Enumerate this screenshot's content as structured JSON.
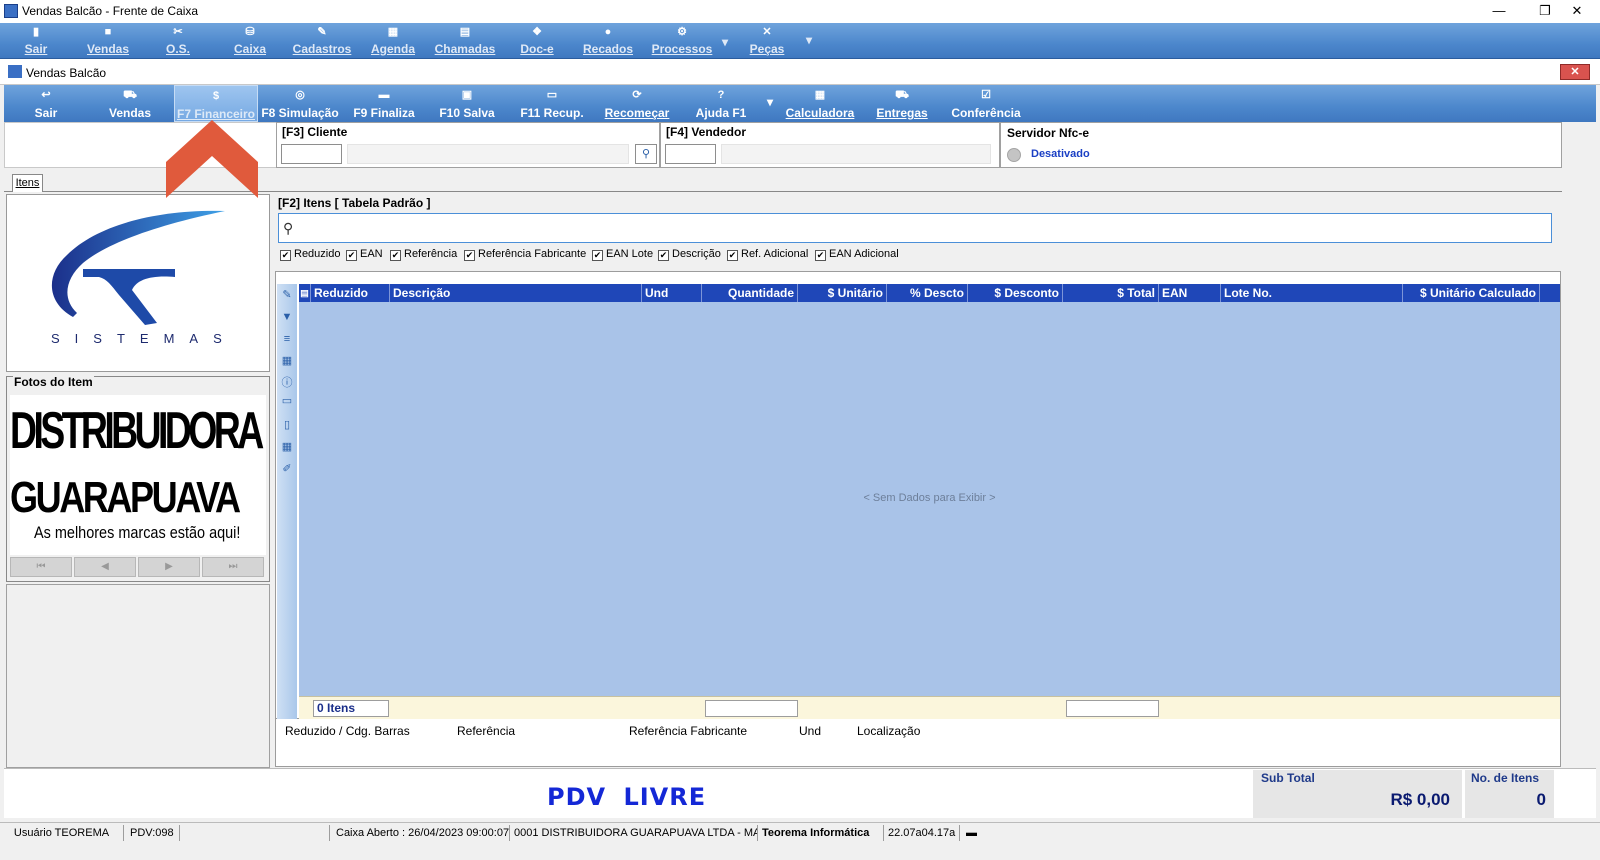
{
  "window": {
    "title": "Vendas Balcão - Frente de Caixa"
  },
  "main_menu": [
    {
      "label": "Sair",
      "icon": "door-icon"
    },
    {
      "label": "Vendas",
      "icon": "cart-icon"
    },
    {
      "label": "O.S.",
      "icon": "tools-icon"
    },
    {
      "label": "Caixa",
      "icon": "cashbox-icon"
    },
    {
      "label": "Cadastros",
      "icon": "register-icon"
    },
    {
      "label": "Agenda",
      "icon": "calendar-icon"
    },
    {
      "label": "Chamadas",
      "icon": "grid-icon"
    },
    {
      "label": "Doc-e",
      "icon": "document-icon"
    },
    {
      "label": "Recados",
      "icon": "chat-icon"
    },
    {
      "label": "Processos",
      "icon": "gear-icon"
    },
    {
      "label": "Peças",
      "icon": "wrench-icon"
    }
  ],
  "inner_window": {
    "title": "Vendas Balcão"
  },
  "toolbar": [
    {
      "label": "Sair",
      "icon": "back-icon"
    },
    {
      "label": "Vendas",
      "icon": "cart-icon"
    },
    {
      "label": "F7 Financeiro",
      "icon": "money-icon"
    },
    {
      "label": "F8 Simulação",
      "icon": "simulation-icon"
    },
    {
      "label": "F9 Finaliza",
      "icon": "printer-icon"
    },
    {
      "label": "F10 Salva",
      "icon": "save-icon"
    },
    {
      "label": "F11 Recup.",
      "icon": "recover-icon"
    },
    {
      "label": "Recomeçar",
      "icon": "refresh-icon"
    },
    {
      "label": "Ajuda F1",
      "icon": "help-icon"
    },
    {
      "label": "Calculadora",
      "icon": "calculator-icon"
    },
    {
      "label": "Entregas",
      "icon": "truck-icon"
    },
    {
      "label": "Conferência",
      "icon": "checkbox-icon"
    }
  ],
  "header": {
    "cliente_label": "[F3] Cliente",
    "vendedor_label": "[F4] Vendedor",
    "servidor_label": "Servidor Nfc-e",
    "servidor_status": "Desativado"
  },
  "tab": {
    "label": "Itens"
  },
  "logo": {
    "text": "SISTEMAS"
  },
  "fotos": {
    "title": "Fotos do Item",
    "photo_line1": "DISTRIBUIDORA",
    "photo_line2": "GUARAPUAVA",
    "photo_line3": "As melhores marcas estão aqui!",
    "nav": [
      "⏮",
      "◀",
      "▶",
      "⏭"
    ]
  },
  "items": {
    "title": "[F2] Itens [ Tabela Padrão ]",
    "search_value": "",
    "filters": [
      {
        "label": "Reduzido",
        "checked": true
      },
      {
        "label": "EAN",
        "checked": true
      },
      {
        "label": "Referência",
        "checked": true
      },
      {
        "label": "Referência Fabricante",
        "checked": true
      },
      {
        "label": "EAN Lote",
        "checked": true
      },
      {
        "label": "Descrição",
        "checked": true
      },
      {
        "label": "Ref. Adicional",
        "checked": true
      },
      {
        "label": "EAN Adicional",
        "checked": true
      }
    ],
    "columns": [
      "Reduzido",
      "Descrição",
      "Und",
      "Quantidade",
      "$ Unitário",
      "% Descto",
      "$ Desconto",
      "$ Total",
      "EAN",
      "Lote No.",
      "$ Unitário Calculado"
    ],
    "rows": [],
    "empty_text": "< Sem Dados para Exibir >",
    "footer_count": "0 Itens"
  },
  "detail": {
    "labels": [
      "Reduzido / Cdg. Barras",
      "Referência",
      "Referência Fabricante",
      "Und",
      "Localização"
    ]
  },
  "bottom": {
    "status": "PDV LIVRE",
    "subtotal_label": "Sub Total",
    "subtotal_value": "R$ 0,00",
    "noitens_label": "No. de Itens",
    "noitens_value": "0"
  },
  "statusbar": {
    "usuario": "Usuário TEOREMA",
    "pdv": "PDV:098",
    "blank": "",
    "caixa": "Caixa Aberto : 26/04/2023 09:00:07",
    "empresa": "0001 DISTRIBUIDORA GUARAPUAVA LTDA - MA",
    "teorema": "Teorema Informática",
    "versao": "22.07a04.17a"
  },
  "colors": {
    "accent": "#4c87cc",
    "grid_header": "#1f47b8",
    "grid_body": "#a9c3e8",
    "pdv_text": "#1428d6",
    "highlight_arrow": "#e05a3c"
  }
}
